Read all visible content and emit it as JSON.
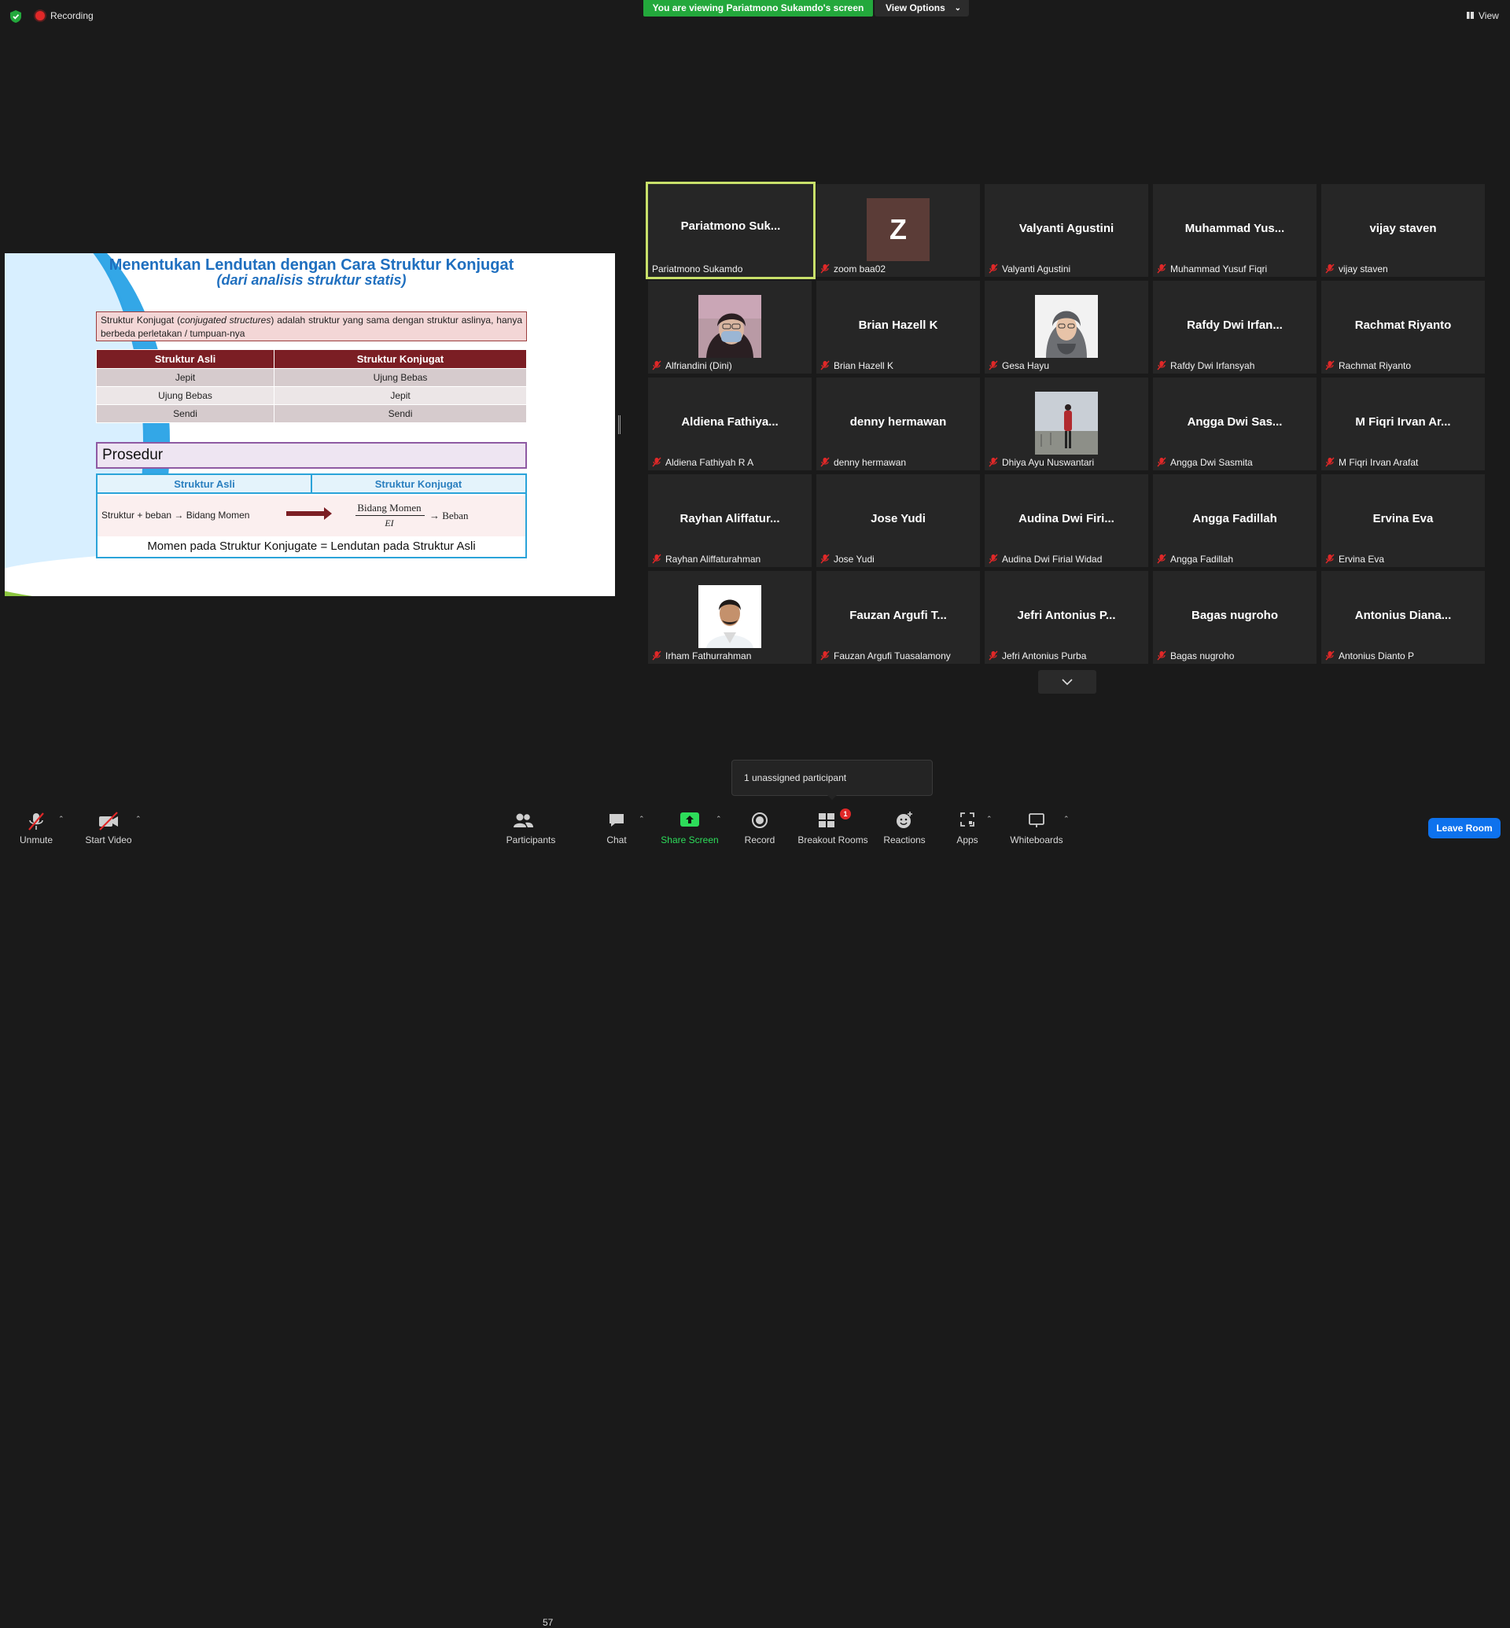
{
  "topbar": {
    "recording_label": "Recording",
    "viewing_banner": "You are viewing Pariatmono Sukamdo's screen",
    "view_options_label": "View Options",
    "view_label": "View"
  },
  "slide": {
    "title": "Menentukan Lendutan dengan Cara Struktur Konjugat",
    "subtitle": "(dari analisis struktur statis)",
    "definition_prefix": "Struktur Konjugat (",
    "definition_italic": "conjugated structures",
    "definition_suffix": ") adalah struktur yang sama dengan struktur aslinya, hanya berbeda perletakan / tumpuan-nya",
    "table": {
      "headers": [
        "Struktur Asli",
        "Struktur Konjugat"
      ],
      "rows": [
        [
          "Jepit",
          "Ujung Bebas"
        ],
        [
          "Ujung Bebas",
          "Jepit"
        ],
        [
          "Sendi",
          "Sendi"
        ]
      ]
    },
    "procedure_title": "Prosedur",
    "procedure": {
      "header_left": "Struktur Asli",
      "header_right": "Struktur Konjugat",
      "left_text": "Struktur + beban → Bidang Momen",
      "fraction_numerator": "Bidang Momen",
      "fraction_denominator": "EI",
      "right_text": "→ Beban",
      "bottom_text": "Momen pada Struktur Konjugate = Lendutan pada Struktur Asli"
    }
  },
  "participants": [
    {
      "big": "Pariatmono  Suk...",
      "small": "Pariatmono Sukamdo",
      "muted": false,
      "active": true,
      "avatar": "none"
    },
    {
      "big": "",
      "small": "zoom baa02",
      "muted": true,
      "avatar": "letter",
      "letter": "Z"
    },
    {
      "big": "Valyanti Agustini",
      "small": "Valyanti Agustini",
      "muted": true,
      "avatar": "none"
    },
    {
      "big": "Muhammad  Yus...",
      "small": "Muhammad Yusuf Fiqri",
      "muted": true,
      "avatar": "none"
    },
    {
      "big": "vijay staven",
      "small": "vijay staven",
      "muted": true,
      "avatar": "none"
    },
    {
      "big": "",
      "small": "Alfriandini (Dini)",
      "muted": true,
      "avatar": "photo-mask"
    },
    {
      "big": "Brian Hazell K",
      "small": "Brian Hazell K",
      "muted": true,
      "avatar": "none"
    },
    {
      "big": "",
      "small": "Gesa Hayu",
      "muted": true,
      "avatar": "photo-hijab"
    },
    {
      "big": "Rafdy Dwi Irfan...",
      "small": "Rafdy Dwi Irfansyah",
      "muted": true,
      "avatar": "none"
    },
    {
      "big": "Rachmat Riyanto",
      "small": "Rachmat Riyanto",
      "muted": true,
      "avatar": "none"
    },
    {
      "big": "Aldiena  Fathiya...",
      "small": "Aldiena Fathiyah R A",
      "muted": true,
      "avatar": "none"
    },
    {
      "big": "denny hermawan",
      "small": "denny hermawan",
      "muted": true,
      "avatar": "none"
    },
    {
      "big": "",
      "small": "Dhiya Ayu Nuswantari",
      "muted": true,
      "avatar": "photo-landscape"
    },
    {
      "big": "Angga Dwi Sas...",
      "small": "Angga Dwi Sasmita",
      "muted": true,
      "avatar": "none"
    },
    {
      "big": "M Fiqri Irvan Ar...",
      "small": "M Fiqri Irvan Arafat",
      "muted": true,
      "avatar": "none"
    },
    {
      "big": "Rayhan  Aliffatur...",
      "small": "Rayhan Aliffaturahman",
      "muted": true,
      "avatar": "none"
    },
    {
      "big": "Jose Yudi",
      "small": "Jose Yudi",
      "muted": true,
      "avatar": "none"
    },
    {
      "big": "Audina  Dwi  Firi...",
      "small": "Audina Dwi Firial Widad",
      "muted": true,
      "avatar": "none"
    },
    {
      "big": "Angga Fadillah",
      "small": "Angga Fadillah",
      "muted": true,
      "avatar": "none"
    },
    {
      "big": "Ervina Eva",
      "small": "Ervina Eva",
      "muted": true,
      "avatar": "none"
    },
    {
      "big": "",
      "small": "Irham Fathurrahman",
      "muted": true,
      "avatar": "photo-man"
    },
    {
      "big": "Fauzan Argufi T...",
      "small": "Fauzan Argufi Tuasalamony",
      "muted": true,
      "avatar": "none"
    },
    {
      "big": "Jefri Antonius P...",
      "small": "Jefri Antonius Purba",
      "muted": true,
      "avatar": "none"
    },
    {
      "big": "Bagas nugroho",
      "small": "Bagas nugroho",
      "muted": true,
      "avatar": "none"
    },
    {
      "big": "Antonius  Diana...",
      "small": "Antonius Dianto P",
      "muted": true,
      "avatar": "none"
    }
  ],
  "tooltip": "1 unassigned participant",
  "toolbar": {
    "unmute": "Unmute",
    "start_video": "Start Video",
    "participants": "Participants",
    "participants_count": "57",
    "chat": "Chat",
    "share_screen": "Share Screen",
    "record": "Record",
    "breakout_rooms": "Breakout Rooms",
    "breakout_badge": "1",
    "reactions": "Reactions",
    "apps": "Apps",
    "whiteboards": "Whiteboards",
    "leave": "Leave Room"
  },
  "colors": {
    "share_green": "#23a83c",
    "active_speaker": "#c8e06a",
    "leave_blue": "#0e72ed",
    "muted_red": "#e02828"
  }
}
